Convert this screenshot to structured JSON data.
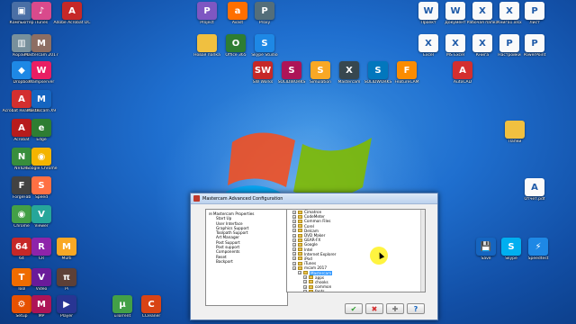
{
  "desktop_icons": [
    {
      "label": "Компьютер",
      "color": "#4a6fa5",
      "glyph": "▣"
    },
    {
      "label": "iTunes",
      "color": "#d94a8c",
      "glyph": "♪"
    },
    {
      "label": "Adobe Acrobat DC",
      "color": "#c62828",
      "glyph": "A"
    },
    {
      "label": "Корзина",
      "color": "#78909c",
      "glyph": "▥"
    },
    {
      "label": "Mastercam 2017",
      "color": "#8d6e63",
      "glyph": "M"
    },
    {
      "label": "Dropbox",
      "color": "#1e88e5",
      "glyph": "◆"
    },
    {
      "label": "Wampserver",
      "color": "#e91e63",
      "glyph": "W"
    },
    {
      "label": "Acrobat Reader DC",
      "color": "#d32f2f",
      "glyph": "A"
    },
    {
      "label": "Mastercam X9",
      "color": "#1565c0",
      "glyph": "M"
    },
    {
      "label": "Acrobat",
      "color": "#b71c1c",
      "glyph": "A"
    },
    {
      "label": "Edge",
      "color": "#2e7d32",
      "glyph": "e"
    },
    {
      "label": "NVIDIA",
      "color": "#388e3c",
      "glyph": "N"
    },
    {
      "label": "Google Chrome",
      "color": "#f4b400",
      "glyph": "◉"
    },
    {
      "label": "ForgeFab",
      "color": "#424242",
      "glyph": "F"
    },
    {
      "label": "Speed",
      "color": "#ff7043",
      "glyph": "S"
    },
    {
      "label": "Chrome",
      "color": "#43a047",
      "glyph": "◉"
    },
    {
      "label": "Viewer",
      "color": "#26a69a",
      "glyph": "V"
    },
    {
      "label": "64",
      "color": "#c62828",
      "glyph": "64"
    },
    {
      "label": "CR",
      "color": "#8e24aa",
      "glyph": "R"
    },
    {
      "label": "Multi",
      "color": "#f9a825",
      "glyph": "M"
    },
    {
      "label": "Tool",
      "color": "#ef6c00",
      "glyph": "T"
    },
    {
      "label": "Video",
      "color": "#6a1b9a",
      "glyph": "V"
    },
    {
      "label": "Pi",
      "color": "#5d4037",
      "glyph": "π"
    },
    {
      "label": "Setup",
      "color": "#e65100",
      "glyph": "⚙"
    },
    {
      "label": "MP",
      "color": "#ad1457",
      "glyph": "M"
    },
    {
      "label": "Player",
      "color": "#283593",
      "glyph": "▶"
    },
    {
      "label": "uTorrent",
      "color": "#43a047",
      "glyph": "μ"
    },
    {
      "label": "CCleaner",
      "color": "#d84315",
      "glyph": "C"
    },
    {
      "label": "Project",
      "color": "#7e57c2",
      "glyph": "P"
    },
    {
      "label": "Avast",
      "color": "#ff6f00",
      "glyph": "a"
    },
    {
      "label": "Proxy",
      "color": "#546e7a",
      "glyph": "P"
    },
    {
      "label": "Новая папка",
      "color": "#f0c040",
      "glyph": ""
    },
    {
      "label": "Office 365",
      "color": "#2e7d32",
      "glyph": "O"
    },
    {
      "label": "Skype Studio",
      "color": "#1e88e5",
      "glyph": "S"
    },
    {
      "label": "SW Works",
      "color": "#c62828",
      "glyph": "SW"
    },
    {
      "label": "SOLIDWORKS",
      "color": "#ad1457",
      "glyph": "S"
    },
    {
      "label": "Simulation",
      "color": "#f9a825",
      "glyph": "S"
    },
    {
      "label": "Mastercam",
      "color": "#37474f",
      "glyph": "X"
    },
    {
      "label": "SOLIDWORKS",
      "color": "#0277bd",
      "glyph": "S"
    },
    {
      "label": "FeatureCAM",
      "color": "#fb8c00",
      "glyph": "F"
    },
    {
      "label": "AutoCAD",
      "color": "#d32f2f",
      "glyph": "A"
    },
    {
      "label": "Проект",
      "color": "#fafafa",
      "glyph": "W"
    },
    {
      "label": "Документ",
      "color": "#fafafa",
      "glyph": "W"
    },
    {
      "label": "Рабочая папка",
      "color": "#fafafa",
      "glyph": "X"
    },
    {
      "label": "Книга1.xlsx",
      "color": "#fafafa",
      "glyph": "X"
    },
    {
      "label": "Лист",
      "color": "#fafafa",
      "glyph": "P"
    },
    {
      "label": "Excel",
      "color": "#fafafa",
      "glyph": "X"
    },
    {
      "label": "MS Excel",
      "color": "#fafafa",
      "glyph": "X"
    },
    {
      "label": "Книга",
      "color": "#fafafa",
      "glyph": "X"
    },
    {
      "label": "Настройки",
      "color": "#fafafa",
      "glyph": "P"
    },
    {
      "label": "PowerPoint",
      "color": "#fafafa",
      "glyph": "P"
    },
    {
      "label": "Папки",
      "color": "#f0c040",
      "glyph": ""
    },
    {
      "label": "Отчёт.pdf",
      "color": "#fafafa",
      "glyph": "A"
    },
    {
      "label": "Save",
      "color": "#1565c0",
      "glyph": "💾"
    },
    {
      "label": "Skype",
      "color": "#00aff0",
      "glyph": "S"
    },
    {
      "label": "Speedtest",
      "color": "#1e88e5",
      "glyph": "⚡"
    }
  ],
  "dialog": {
    "title": "Mastercam Advanced Configuration",
    "left_tree": [
      {
        "label": "Mastercam Properties",
        "child": false
      },
      {
        "label": "Start Up",
        "child": true
      },
      {
        "label": "User Interface",
        "child": true
      },
      {
        "label": "Graphics Support",
        "child": true
      },
      {
        "label": "Toolpath Support",
        "child": true
      },
      {
        "label": "Art Manager",
        "child": true
      },
      {
        "label": "Post Support",
        "child": true
      },
      {
        "label": "Post support",
        "child": true
      },
      {
        "label": "Components",
        "child": true
      },
      {
        "label": "Reset",
        "child": true
      },
      {
        "label": "Backport",
        "child": true
      }
    ],
    "right_tree": [
      {
        "label": "Cimatron",
        "indent": 1,
        "selected": false
      },
      {
        "label": "CodeMeter",
        "indent": 1,
        "selected": false
      },
      {
        "label": "Common Files",
        "indent": 1,
        "selected": false
      },
      {
        "label": "Corel",
        "indent": 1,
        "selected": false
      },
      {
        "label": "Delcam",
        "indent": 1,
        "selected": false
      },
      {
        "label": "DVD Maker",
        "indent": 1,
        "selected": false
      },
      {
        "label": "GEAR-FX",
        "indent": 1,
        "selected": false
      },
      {
        "label": "Google",
        "indent": 1,
        "selected": false
      },
      {
        "label": "Intel",
        "indent": 1,
        "selected": false
      },
      {
        "label": "Internet Explorer",
        "indent": 1,
        "selected": false
      },
      {
        "label": "iPod",
        "indent": 1,
        "selected": false
      },
      {
        "label": "iTunes",
        "indent": 1,
        "selected": false
      },
      {
        "label": "mcam 2017",
        "indent": 1,
        "selected": false
      },
      {
        "label": "Mastercam",
        "indent": 2,
        "selected": true
      },
      {
        "label": "apps",
        "indent": 3,
        "selected": false
      },
      {
        "label": "chooks",
        "indent": 3,
        "selected": false
      },
      {
        "label": "common",
        "indent": 3,
        "selected": false
      },
      {
        "label": "fonts",
        "indent": 3,
        "selected": false
      }
    ],
    "buttons": {
      "ok": "✔",
      "cancel": "✖",
      "add": "✚",
      "help": "?"
    }
  }
}
